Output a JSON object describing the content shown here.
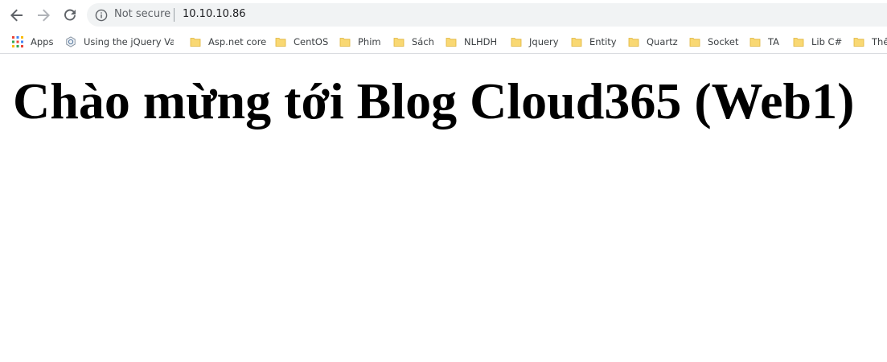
{
  "browser": {
    "security_label": "Not secure",
    "url": "10.10.10.86"
  },
  "bookmarks": [
    {
      "label": "Apps",
      "icon": "apps-grid-icon"
    },
    {
      "label": "Using the jQuery Vali",
      "icon": "web-globe-icon"
    },
    {
      "label": "Asp.net core",
      "icon": "folder-icon"
    },
    {
      "label": "CentOS",
      "icon": "folder-icon"
    },
    {
      "label": "Phim",
      "icon": "folder-icon"
    },
    {
      "label": "Sách",
      "icon": "folder-icon"
    },
    {
      "label": "NLHDH",
      "icon": "folder-icon"
    },
    {
      "label": "Jquery",
      "icon": "folder-icon"
    },
    {
      "label": "Entity",
      "icon": "folder-icon"
    },
    {
      "label": "Quartz",
      "icon": "folder-icon"
    },
    {
      "label": "Socket",
      "icon": "folder-icon"
    },
    {
      "label": "TA",
      "icon": "folder-icon"
    },
    {
      "label": "Lib C#",
      "icon": "folder-icon"
    },
    {
      "label": "Thể",
      "icon": "folder-icon"
    }
  ],
  "colors": {
    "folder": "#f9d873",
    "folder_border": "#e0b43b",
    "toolbar_icon": "#5f6368"
  },
  "page": {
    "heading": "Chào mừng tới Blog Cloud365 (Web1)"
  }
}
